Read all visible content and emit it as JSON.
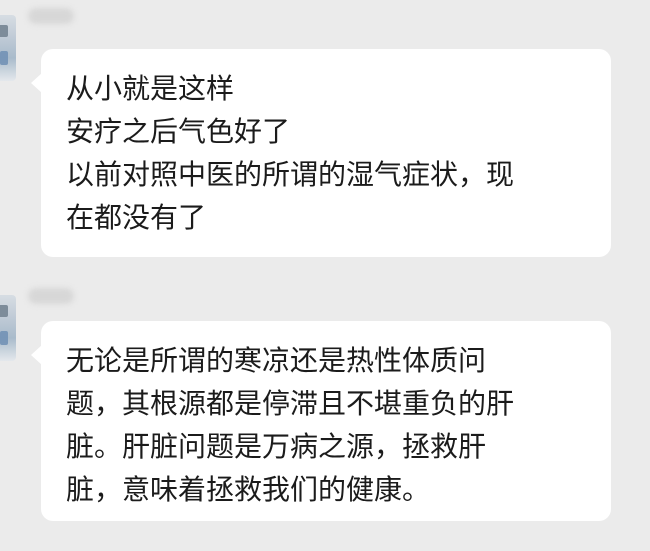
{
  "messages": [
    {
      "lines": [
        "从小就是这样",
        "安疗之后气色好了",
        "以前对照中医的所谓的湿气症状，现",
        "在都没有了"
      ]
    },
    {
      "lines": [
        "无论是所谓的寒凉还是热性体质问",
        "题，其根源都是停滞且不堪重负的肝",
        "脏。肝脏问题是万病之源，拯救肝",
        "脏，意味着拯救我们的健康。"
      ]
    }
  ]
}
